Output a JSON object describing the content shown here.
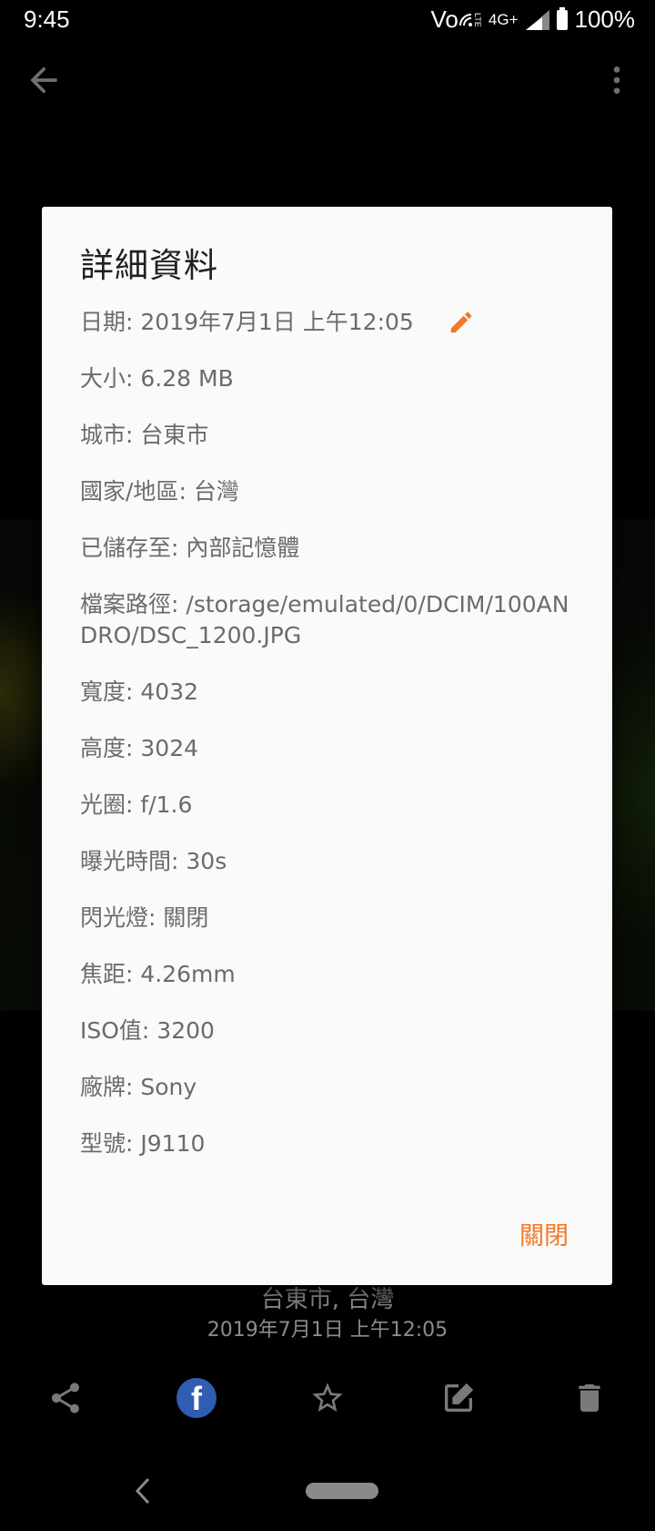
{
  "status_bar": {
    "time": "9:45",
    "network_label": "Vo",
    "volte_sub": "LTE",
    "network_type": "4G+",
    "battery": "100%"
  },
  "top_bar": {
    "back_icon": "arrow-back-icon",
    "more_icon": "more-vert-icon"
  },
  "dialog": {
    "title": "詳細資料",
    "separator": ": ",
    "rows": [
      {
        "label": "日期",
        "value": "2019年7月1日 上午12:05"
      },
      {
        "label": "大小",
        "value": "6.28 MB"
      },
      {
        "label": "城市",
        "value": "台東市"
      },
      {
        "label": "國家/地區",
        "value": "台灣"
      },
      {
        "label": "已儲存至",
        "value": "內部記憶體"
      },
      {
        "label": "檔案路徑",
        "value": "/storage/emulated/0/DCIM/100ANDRO/DSC_1200.JPG"
      },
      {
        "label": "寬度",
        "value": "4032"
      },
      {
        "label": "高度",
        "value": "3024"
      },
      {
        "label": "光圈",
        "value": "f/1.6"
      },
      {
        "label": "曝光時間",
        "value": "30s"
      },
      {
        "label": "閃光燈",
        "value": "關閉"
      },
      {
        "label": "焦距",
        "value": "4.26mm"
      },
      {
        "label": "ISO值",
        "value": "3200"
      },
      {
        "label": "廠牌",
        "value": "Sony"
      },
      {
        "label": "型號",
        "value": "J9110"
      }
    ],
    "close_label": "關閉",
    "accent_color": "#ef7a26"
  },
  "caption": {
    "city": "台東市, 台灣",
    "date": "2019年7月1日 上午12:05"
  },
  "actions": [
    {
      "icon": "share-icon"
    },
    {
      "icon": "facebook-icon",
      "letter": "f"
    },
    {
      "icon": "star-icon"
    },
    {
      "icon": "edit-icon"
    },
    {
      "icon": "delete-icon"
    }
  ]
}
